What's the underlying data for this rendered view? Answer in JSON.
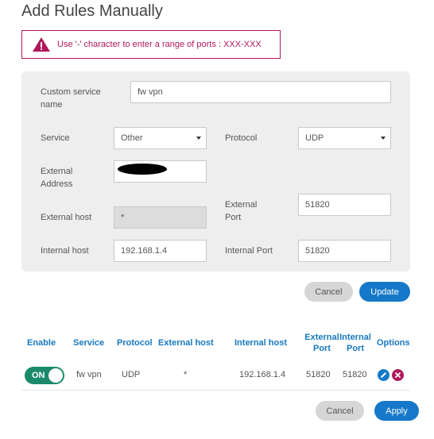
{
  "title": "Add Rules Manually",
  "alert": {
    "message": "Use '-' character to enter a range of ports : XXX-XXX",
    "icon": "warning-icon"
  },
  "form": {
    "custom_service_name_label": "Custom service name",
    "custom_service_name_value": "fw vpn",
    "service_label": "Service",
    "service_value": "Other",
    "protocol_label": "Protocol",
    "protocol_value": "UDP",
    "external_address_label": "External Address",
    "external_address_value": "",
    "external_host_label": "External host",
    "external_host_value": "*",
    "external_port_label": "External Port",
    "external_port_value": "51820",
    "internal_host_label": "Internal host",
    "internal_host_value": "192.168.1.4",
    "internal_port_label": "Internal Port",
    "internal_port_value": "51820",
    "cancel_label": "Cancel",
    "update_label": "Update"
  },
  "table": {
    "headers": {
      "enable": "Enable",
      "service": "Service",
      "protocol": "Protocol",
      "external_host": "External host",
      "internal_host": "Internal host",
      "external_port": "External Port",
      "internal_port": "Internal Port",
      "options": "Options"
    },
    "rows": [
      {
        "enable": "ON",
        "service": "fw vpn",
        "protocol": "UDP",
        "external_host": "*",
        "internal_host": "192.168.1.4",
        "external_port": "51820",
        "internal_port": "51820"
      }
    ]
  },
  "footer": {
    "cancel_label": "Cancel",
    "apply_label": "Apply"
  },
  "colors": {
    "accent": "#1678c8",
    "alert": "#b0185a",
    "toggle_on": "#1a8a6b",
    "delete": "#b0185a"
  }
}
